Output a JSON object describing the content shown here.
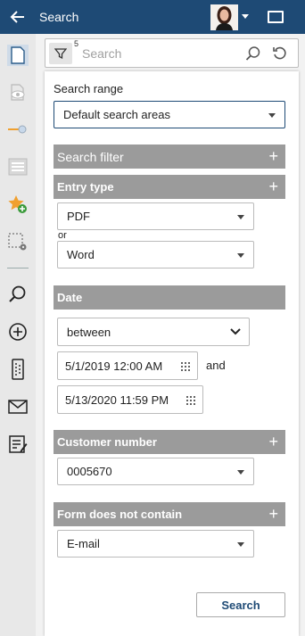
{
  "header": {
    "title": "Search"
  },
  "sidebar": {
    "icons": [
      "document-icon",
      "preview-icon",
      "pin-icon",
      "list-icon",
      "star-add-icon",
      "selection-settings-icon",
      "search-icon",
      "add-circle-icon",
      "barcode-device-icon",
      "mail-icon",
      "edit-form-icon"
    ]
  },
  "searchbar": {
    "filter_count": "5",
    "placeholder": "Search"
  },
  "panel": {
    "search_range_label": "Search range",
    "search_range_value": "Default search areas",
    "search_filter_label": "Search filter",
    "entry_type_label": "Entry type",
    "entry_type_1": "PDF",
    "or_label": "or",
    "entry_type_2": "Word",
    "date_label": "Date",
    "date_operator": "between",
    "date_from": "5/1/2019 12:00 AM",
    "and_label": "and",
    "date_to": "5/13/2020 11:59 PM",
    "customer_number_label": "Customer number",
    "customer_number_value": "0005670",
    "form_not_contain_label": "Form does not contain",
    "form_not_contain_value": "E-mail",
    "search_button": "Search"
  },
  "colors": {
    "topbar": "#1e4a75",
    "section_header": "#9b9b9b",
    "accent_orange": "#f0a030"
  }
}
